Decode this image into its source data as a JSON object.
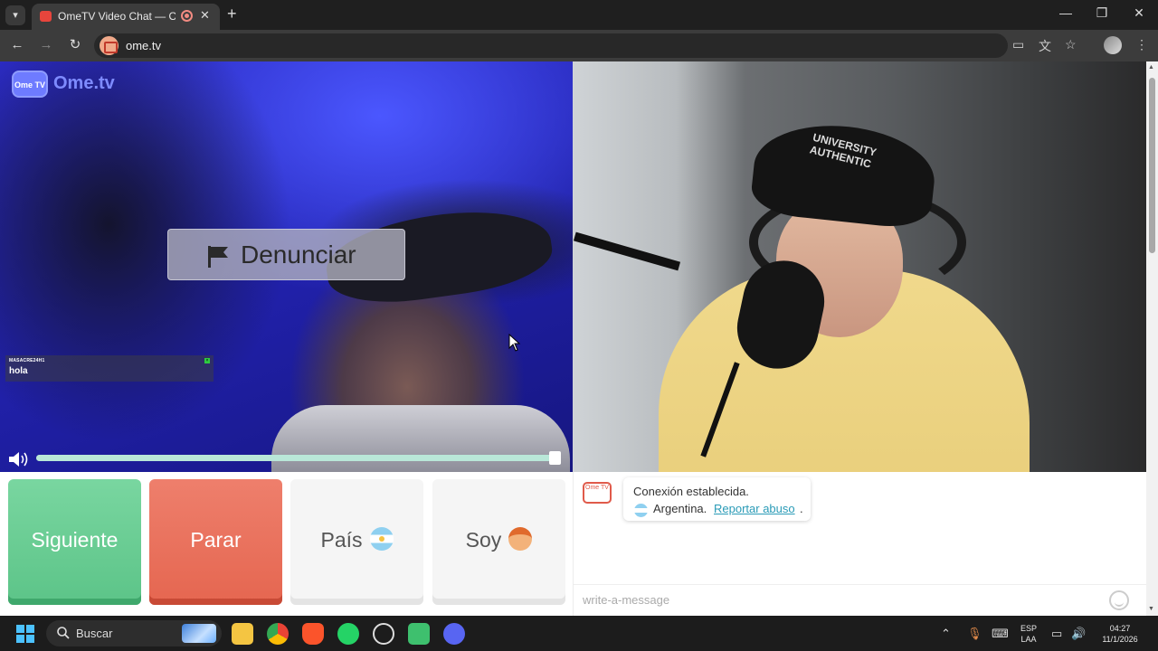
{
  "browser": {
    "tab_title": "OmeTV Video Chat — Omegle",
    "url": "ome.tv",
    "new_tab_symbol": "+",
    "close_tab_symbol": "✕",
    "window_controls": {
      "minimize": "—",
      "maximize": "❐",
      "close": "✕"
    }
  },
  "remote": {
    "logo_badge": "Ome TV",
    "logo_text": "Ome.tv",
    "report_label": "Denunciar",
    "chat_username": "MASACRE24H1",
    "chat_message": "hola",
    "volume_percent": 100
  },
  "local": {
    "cap_text": "UNIVERSITY AUTHENTIC"
  },
  "controls": {
    "next_label": "Siguiente",
    "stop_label": "Parar",
    "country_label": "País",
    "gender_label": "Soy"
  },
  "chat": {
    "system_icon_text": "Ome TV",
    "connection_text": "Conexión establecida.",
    "country": "Argentina.",
    "report_link": "Reportar abuso",
    "period": ".",
    "input_placeholder": "write-a-message"
  },
  "taskbar": {
    "search_label": "Buscar",
    "language_top": "ESP",
    "language_bottom": "LAA",
    "time": "04:27",
    "date": "11/1/2026"
  },
  "colors": {
    "next": "#5cc488",
    "stop": "#e56650",
    "link": "#2a9bb7",
    "volume_fill": "#b9e7d8"
  },
  "icons": [
    "flag-icon",
    "volume-icon",
    "emoji-icon",
    "search-icon",
    "windows-start-icon",
    "argentina-flag-icon",
    "boy-icon"
  ]
}
